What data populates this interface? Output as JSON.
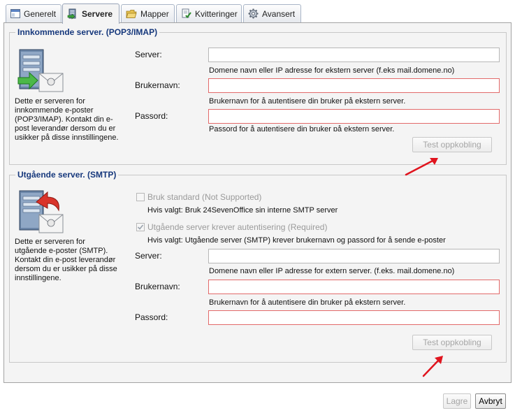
{
  "tabs": [
    {
      "label": "Generelt",
      "icon": "window-icon",
      "active": false
    },
    {
      "label": "Servere",
      "icon": "server-icon",
      "active": true
    },
    {
      "label": "Mapper",
      "icon": "folder-icon",
      "active": false
    },
    {
      "label": "Kvitteringer",
      "icon": "receipt-icon",
      "active": false
    },
    {
      "label": "Avansert",
      "icon": "gear-icon",
      "active": false
    }
  ],
  "incoming": {
    "legend": "Innkommende server. (POP3/IMAP)",
    "description": [
      "Dette er serveren for",
      "innkommende e-poster",
      "(POP3/IMAP). Kontakt din e-",
      "post leverandør dersom du er",
      "usikker på disse innstillingene."
    ],
    "server_label": "Server:",
    "server_value": "",
    "server_hint": "Domene navn eller IP adresse for ekstern server (f.eks mail.domene.no)",
    "username_label": "Brukernavn:",
    "username_value": "",
    "username_hint": "Brukernavn for å autentisere din bruker på ekstern server.",
    "password_label": "Passord:",
    "password_value": "",
    "password_hint": "Passord for å autentisere din bruker på ekstern server.",
    "test_button": "Test oppkobling"
  },
  "outgoing": {
    "legend": "Utgående server. (SMTP)",
    "description": [
      "Dette er serveren for",
      "utgående e-poster (SMTP).",
      "Kontakt din e-post leverandør",
      "dersom du er usikker på disse",
      "innstillingene."
    ],
    "use_standard_label": "Bruk standard (Not Supported)",
    "use_standard_checked": false,
    "use_standard_hint": "Hvis valgt: Bruk 24SevenOffice sin interne SMTP server",
    "auth_label": "Utgående server krever autentisering (Required)",
    "auth_checked": true,
    "auth_hint": "Hvis valgt: Utgående server (SMTP) krever brukernavn og passord for å sende e-poster",
    "server_label": "Server:",
    "server_value": "",
    "server_hint": "Domene navn eller IP adresse for extern server. (f.eks. mail.domene.no)",
    "username_label": "Brukernavn:",
    "username_value": "",
    "username_hint": "Brukernavn for å autentisere din bruker på ekstern server.",
    "password_label": "Passord:",
    "password_value": "",
    "test_button": "Test oppkobling"
  },
  "footer": {
    "save_label": "Lagre",
    "cancel_label": "Avbryt"
  },
  "colors": {
    "legend": "#16387c",
    "error_border": "#e26a6a",
    "annotation_arrow": "#e0141e"
  }
}
